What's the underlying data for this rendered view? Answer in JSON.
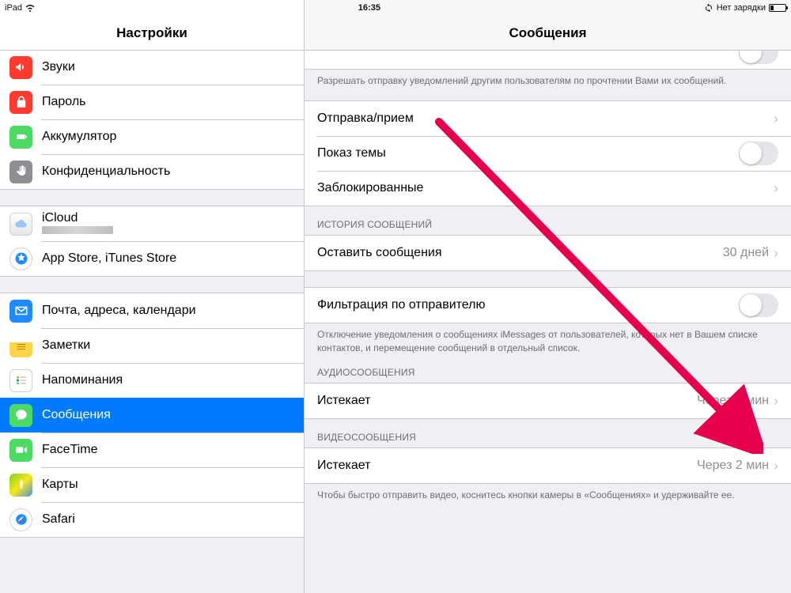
{
  "status": {
    "device": "iPad",
    "time": "16:35",
    "charge_text": "Нет зарядки"
  },
  "left_title": "Настройки",
  "right_title": "Сообщения",
  "sidebar": {
    "g1": [
      {
        "label": "Звуки",
        "icon": "speaker-icon",
        "color": "#ff3b30"
      },
      {
        "label": "Пароль",
        "icon": "lock-icon",
        "color": "#ff3b30"
      },
      {
        "label": "Аккумулятор",
        "icon": "battery-icon",
        "color": "#4cd964"
      },
      {
        "label": "Конфиденциальность",
        "icon": "hand-icon",
        "color": "#8e8e93"
      }
    ],
    "g2": [
      {
        "label": "iCloud",
        "icon": "icloud-icon",
        "color": "#ffffff",
        "has_sub": true
      },
      {
        "label": "App Store, iTunes Store",
        "icon": "appstore-icon",
        "color": "#ffffff"
      }
    ],
    "g3": [
      {
        "label": "Почта, адреса, календари",
        "icon": "mail-icon",
        "color": "#1f8bff"
      },
      {
        "label": "Заметки",
        "icon": "notes-icon",
        "color": "#ffcc00"
      },
      {
        "label": "Напоминания",
        "icon": "reminders-icon",
        "color": "#ffffff"
      },
      {
        "label": "Сообщения",
        "icon": "messages-icon",
        "color": "#4cd964",
        "selected": true
      },
      {
        "label": "FaceTime",
        "icon": "facetime-icon",
        "color": "#4cd964"
      },
      {
        "label": "Карты",
        "icon": "maps-icon",
        "color": "#ffffff"
      },
      {
        "label": "Safari",
        "icon": "safari-icon",
        "color": "#ffffff"
      }
    ]
  },
  "detail": {
    "read_receipts_footer": "Разрешать отправку уведомлений другим пользователям по прочтении Вами их сообщений.",
    "sendreceive": "Отправка/прием",
    "subject": "Показ темы",
    "blocked": "Заблокированные",
    "history_header": "ИСТОРИЯ СООБЩЕНИЙ",
    "keep_label": "Оставить сообщения",
    "keep_value": "30 дней",
    "filter_label": "Фильтрация по отправителю",
    "filter_footer": "Отключение уведомления о сообщениях iMessages от пользователей, которых нет в Вашем списке контактов, и перемещение сообщений  в отдельный список.",
    "audio_header": "АУДИОСООБЩЕНИЯ",
    "expire_label": "Истекает",
    "expire_value": "Через 2 мин",
    "video_header": "ВИДЕОСООБЩЕНИЯ",
    "video_footer": "Чтобы быстро отправить видео, коснитесь кнопки камеры в «Сообщениях» и удерживайте ее."
  }
}
